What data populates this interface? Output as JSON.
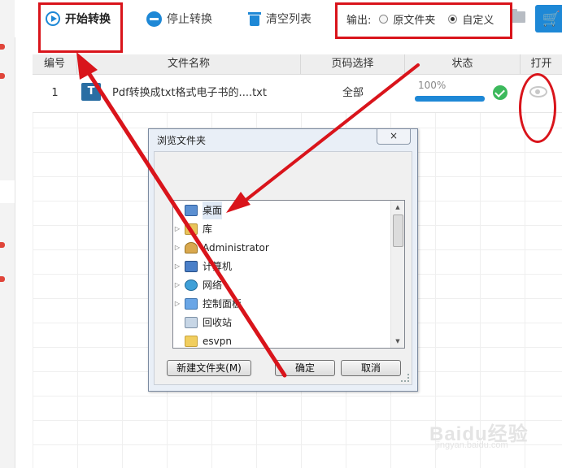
{
  "toolbar": {
    "start_label": "开始转换",
    "stop_label": "停止转换",
    "clear_label": "清空列表",
    "output_label": "输出:",
    "output_options": [
      "原文件夹",
      "自定义"
    ],
    "output_selected": "自定义"
  },
  "table": {
    "headers": [
      "编号",
      "文件名称",
      "页码选择",
      "状态",
      "打开"
    ],
    "rows": [
      {
        "index": "1",
        "file_icon_letter": "T",
        "file_name": "Pdf转换成txt格式电子书的....txt",
        "pages": "全部",
        "progress_text": "100%",
        "progress": 1.0
      }
    ]
  },
  "dialog": {
    "title": "浏览文件夹",
    "close_label": "×",
    "tree_items": [
      {
        "label": "桌面",
        "icon": "desktop-icon"
      },
      {
        "label": "库",
        "icon": "library-icon"
      },
      {
        "label": "Administrator",
        "icon": "user-folder-icon"
      },
      {
        "label": "计算机",
        "icon": "computer-icon"
      },
      {
        "label": "网络",
        "icon": "network-icon"
      },
      {
        "label": "控制面板",
        "icon": "control-panel-icon"
      },
      {
        "label": "回收站",
        "icon": "recycle-bin-icon"
      },
      {
        "label": "esvpn",
        "icon": "folder-icon"
      }
    ],
    "new_folder_label": "新建文件夹(M)",
    "ok_label": "确定",
    "cancel_label": "取消"
  },
  "watermark": {
    "main": "Baidu经验",
    "sub": "jingyan.baidu.com"
  },
  "colors": {
    "accent": "#1e88d6",
    "success": "#3cb95c",
    "annotation": "#d9141b"
  }
}
